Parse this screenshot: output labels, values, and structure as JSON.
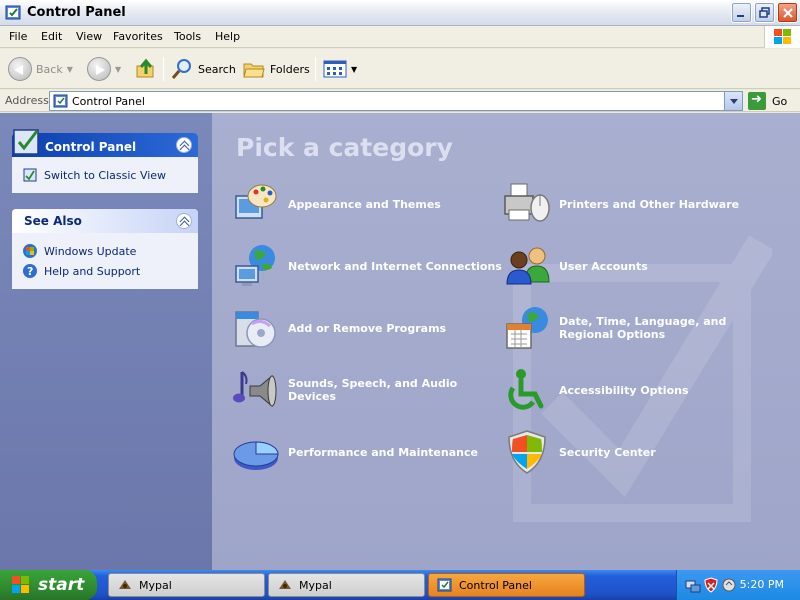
{
  "window": {
    "title": "Control Panel"
  },
  "menu": [
    "File",
    "Edit",
    "View",
    "Favorites",
    "Tools",
    "Help"
  ],
  "toolbar": {
    "back": "Back",
    "search": "Search",
    "folders": "Folders"
  },
  "address": {
    "label": "Address",
    "value": "Control Panel",
    "go": "Go"
  },
  "sidebar": {
    "control_panel": {
      "title": "Control Panel",
      "link": "Switch to Classic View"
    },
    "see_also": {
      "title": "See Also",
      "links": [
        "Windows Update",
        "Help and Support"
      ]
    }
  },
  "main": {
    "heading": "Pick a category",
    "categories": [
      {
        "label": "Appearance and Themes",
        "icon": "appearance-icon"
      },
      {
        "label": "Printers and Other Hardware",
        "icon": "printer-icon"
      },
      {
        "label": "Network and Internet Connections",
        "icon": "network-icon"
      },
      {
        "label": "User Accounts",
        "icon": "users-icon"
      },
      {
        "label": "Add or Remove Programs",
        "icon": "programs-icon"
      },
      {
        "label": "Date, Time, Language, and Regional Options",
        "icon": "datetime-icon"
      },
      {
        "label": "Sounds, Speech, and Audio Devices",
        "icon": "sound-icon"
      },
      {
        "label": "Accessibility Options",
        "icon": "accessibility-icon"
      },
      {
        "label": "Performance and Maintenance",
        "icon": "performance-icon"
      },
      {
        "label": "Security Center",
        "icon": "shield-icon"
      }
    ]
  },
  "taskbar": {
    "start": "start",
    "tasks": [
      "Mypal",
      "Mypal",
      "Control Panel"
    ],
    "clock": "5:20 PM"
  },
  "colors": {
    "taskbar": "#245edb",
    "start": "#2f8a2f",
    "main_bg": "#9ea5c9",
    "sidebar_bg": "#6b77aa"
  }
}
